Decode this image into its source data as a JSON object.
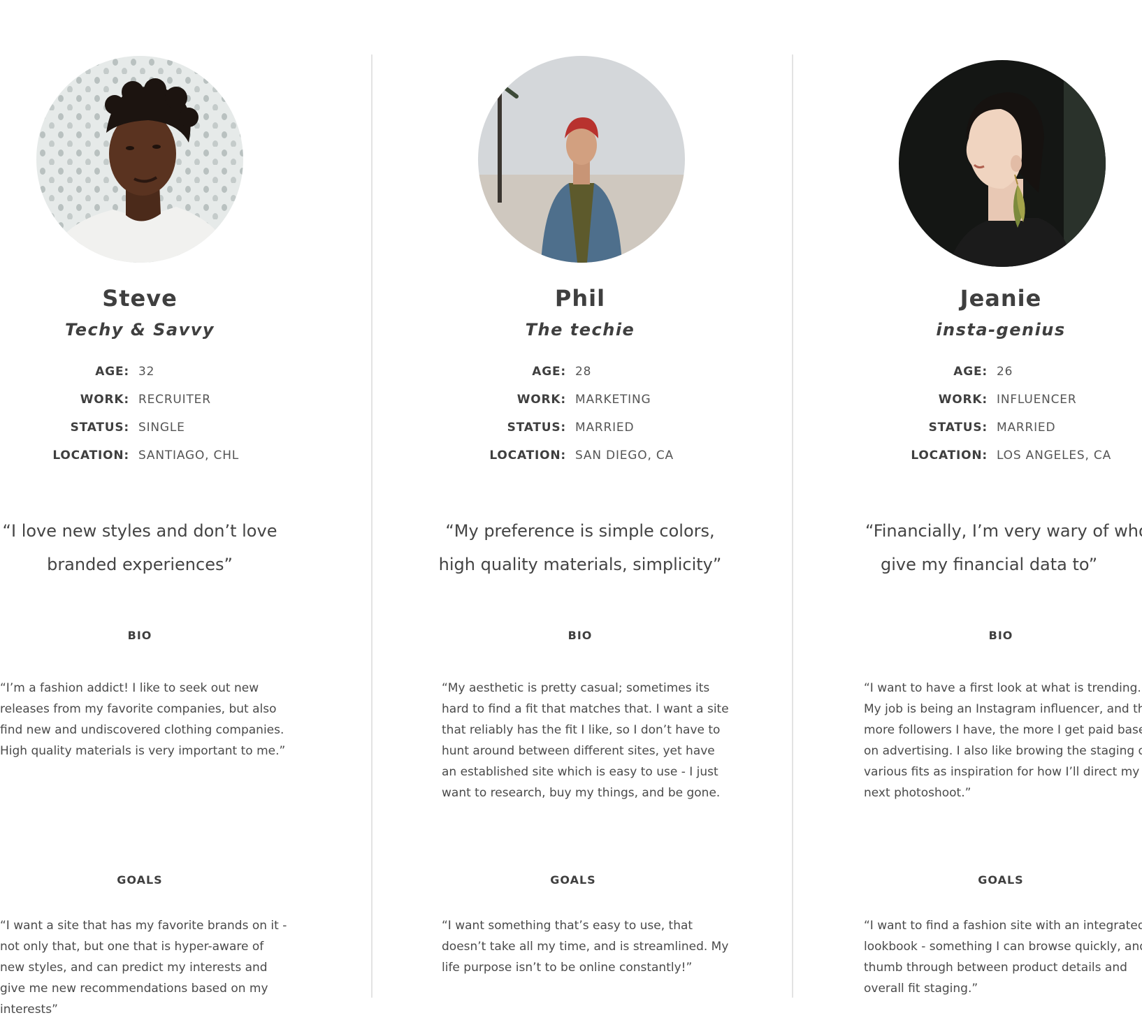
{
  "personas": [
    {
      "name": "Steve",
      "tagline": "Techy & Savvy",
      "facts": [
        {
          "label": "AGE:",
          "value": "32"
        },
        {
          "label": "WORK:",
          "value": "RECRUITER"
        },
        {
          "label": "STATUS:",
          "value": "SINGLE"
        },
        {
          "label": "LOCATION:",
          "value": "SANTIAGO, CHL"
        }
      ],
      "quote_lines": [
        "“I love new styles and don’t love",
        "branded experiences”"
      ],
      "bio_title": "BIO",
      "bio_lines": [
        "“I’m a fashion addict! I like to seek out new",
        "releases from my favorite companies, but also",
        "find new and undiscovered clothing companies.",
        "High quality materials is very important to me.”"
      ],
      "goals_title": "GOALS",
      "goals_lines": [
        "“I want a site that has my favorite brands on it -",
        "not only that, but one that is hyper-aware of",
        "new styles, and can predict my interests and",
        "give me new recommendations based on my",
        "interests”"
      ]
    },
    {
      "name": "Phil",
      "tagline": "The techie",
      "facts": [
        {
          "label": "AGE:",
          "value": "28"
        },
        {
          "label": "WORK:",
          "value": "MARKETING"
        },
        {
          "label": "STATUS:",
          "value": "MARRIED"
        },
        {
          "label": "LOCATION:",
          "value": "SAN DIEGO, CA"
        }
      ],
      "quote_lines": [
        "“My preference is simple colors,",
        "high quality materials, simplicity”"
      ],
      "bio_title": "BIO",
      "bio_lines": [
        "“My aesthetic is pretty casual; sometimes its",
        "hard to find a fit that matches that. I want a site",
        "that reliably has the fit I like, so I don’t have to",
        "hunt around between different sites, yet have",
        "an established site which is easy to use - I just",
        "want to research, buy my things, and be gone."
      ],
      "goals_title": "GOALS",
      "goals_lines": [
        "“I want something that’s easy to use, that",
        "doesn’t take all my time, and is streamlined. My",
        "life purpose isn’t to be online constantly!”"
      ]
    },
    {
      "name": "Jeanie",
      "tagline": "insta-genius",
      "facts": [
        {
          "label": "AGE:",
          "value": "26"
        },
        {
          "label": "WORK:",
          "value": "INFLUENCER"
        },
        {
          "label": "STATUS:",
          "value": "MARRIED"
        },
        {
          "label": "LOCATION:",
          "value": "LOS ANGELES, CA"
        }
      ],
      "quote_lines": [
        "“Financially, I’m very wary of who I",
        "give my financial data to”"
      ],
      "bio_title": "BIO",
      "bio_lines": [
        "“I want to have a first look at what is trending.",
        "My job is being an Instagram influencer, and the",
        "more followers I have, the more I get paid based",
        "on advertising. I also like browing the staging of",
        "various fits as inspiration for how I’ll direct my",
        "next photoshoot.”"
      ],
      "goals_title": "GOALS",
      "goals_lines": [
        "“I want to find a fashion site with an integrated",
        "lookbook - something I can browse quickly, and",
        "thumb through between product details and",
        "overall fit staging.”"
      ]
    }
  ],
  "colors": {
    "text": "#444444",
    "divider": "#e3e3e3",
    "background": "#ffffff"
  }
}
